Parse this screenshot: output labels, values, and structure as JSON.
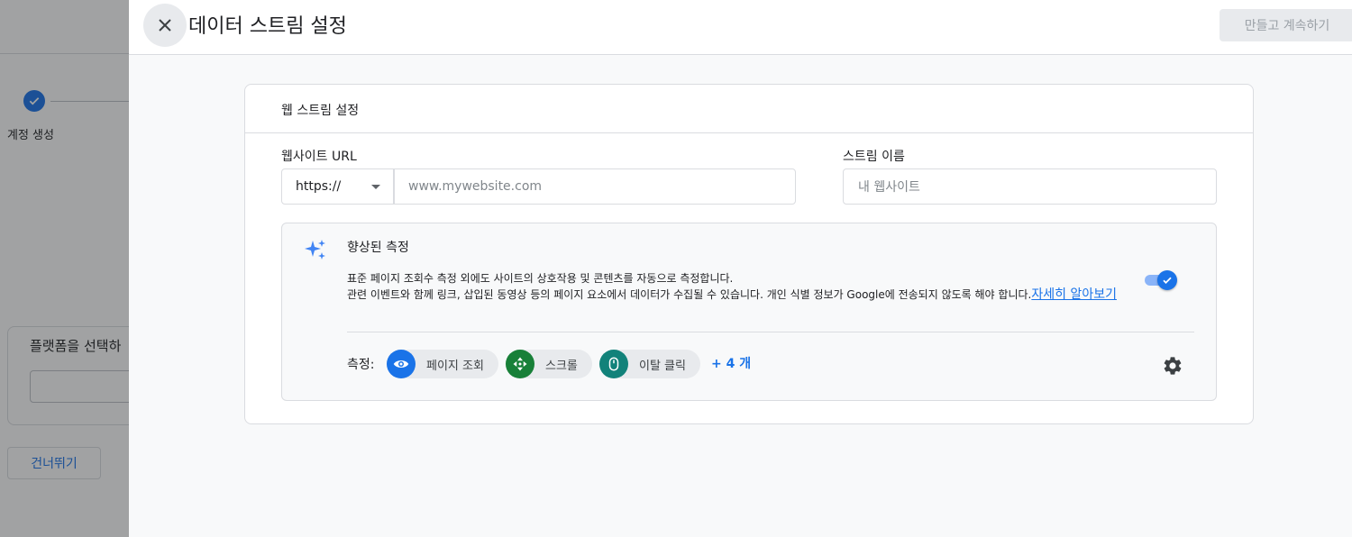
{
  "background": {
    "step_label": "계정 생성",
    "platform_title": "플랫폼을 선택하",
    "skip_button": "건너뛰기"
  },
  "drawer": {
    "title": "데이터 스트림 설정",
    "create_button": "만들고 계속하기"
  },
  "card": {
    "title": "웹 스트림 설정",
    "website_url_label": "웹사이트 URL",
    "protocol_value": "https://",
    "url_placeholder": "www.mywebsite.com",
    "stream_name_label": "스트림 이름",
    "stream_name_placeholder": "내 웹사이트"
  },
  "enhanced_measurement": {
    "title": "향상된 측정",
    "desc_line1": "표준 페이지 조회수 측정 외에도 사이트의 상호작용 및 콘텐츠를 자동으로 측정합니다.",
    "desc_line2": "관련 이벤트와 함께 링크, 삽입된 동영상 등의 페이지 요소에서 데이터가 수집될 수 있습니다. 개인 식별 정보가 Google에 전송되지 않도록 해야 합니다.",
    "learn_more": "자세히 알아보기",
    "toggle_on": true,
    "measurements_label": "측정:",
    "chips": [
      {
        "label": "페이지 조회",
        "icon": "eye-icon",
        "color": "#1a73e8"
      },
      {
        "label": "스크롤",
        "icon": "scroll-icon",
        "color": "#188038"
      },
      {
        "label": "이탈 클릭",
        "icon": "mouse-icon",
        "color": "#12827a"
      }
    ],
    "more": "+ 4 개"
  }
}
